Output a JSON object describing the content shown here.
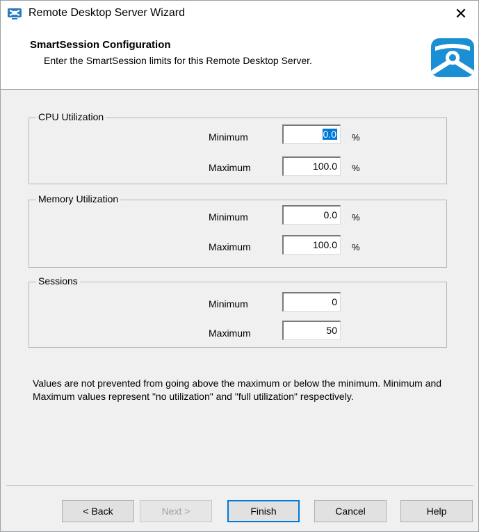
{
  "window": {
    "title": "Remote Desktop Server Wizard",
    "close_glyph": "✕",
    "icon": "remote-desktop-icon"
  },
  "header": {
    "title": "SmartSession Configuration",
    "subtitle": "Enter the SmartSession limits for this Remote Desktop Server.",
    "logo": "thinmanager-logo-icon"
  },
  "groups": {
    "cpu": {
      "legend": "CPU Utilization",
      "min_label": "Minimum",
      "min_value": "0.0",
      "max_label": "Maximum",
      "max_value": "100.0",
      "unit": "%"
    },
    "memory": {
      "legend": "Memory Utilization",
      "min_label": "Minimum",
      "min_value": "0.0",
      "max_label": "Maximum",
      "max_value": "100.0",
      "unit": "%"
    },
    "sessions": {
      "legend": "Sessions",
      "min_label": "Minimum",
      "min_value": "0",
      "max_label": "Maximum",
      "max_value": "50"
    }
  },
  "note": "Values are not prevented from going above the maximum or below the minimum. Minimum and Maximum values represent \"no utilization\" and \"full utilization\" respectively.",
  "buttons": {
    "back": "< Back",
    "next": "Next >",
    "finish": "Finish",
    "cancel": "Cancel",
    "help": "Help"
  },
  "colors": {
    "accent": "#0078d7",
    "dialog_bg": "#f0f0f0",
    "logo_blue": "#1b8fd4"
  }
}
